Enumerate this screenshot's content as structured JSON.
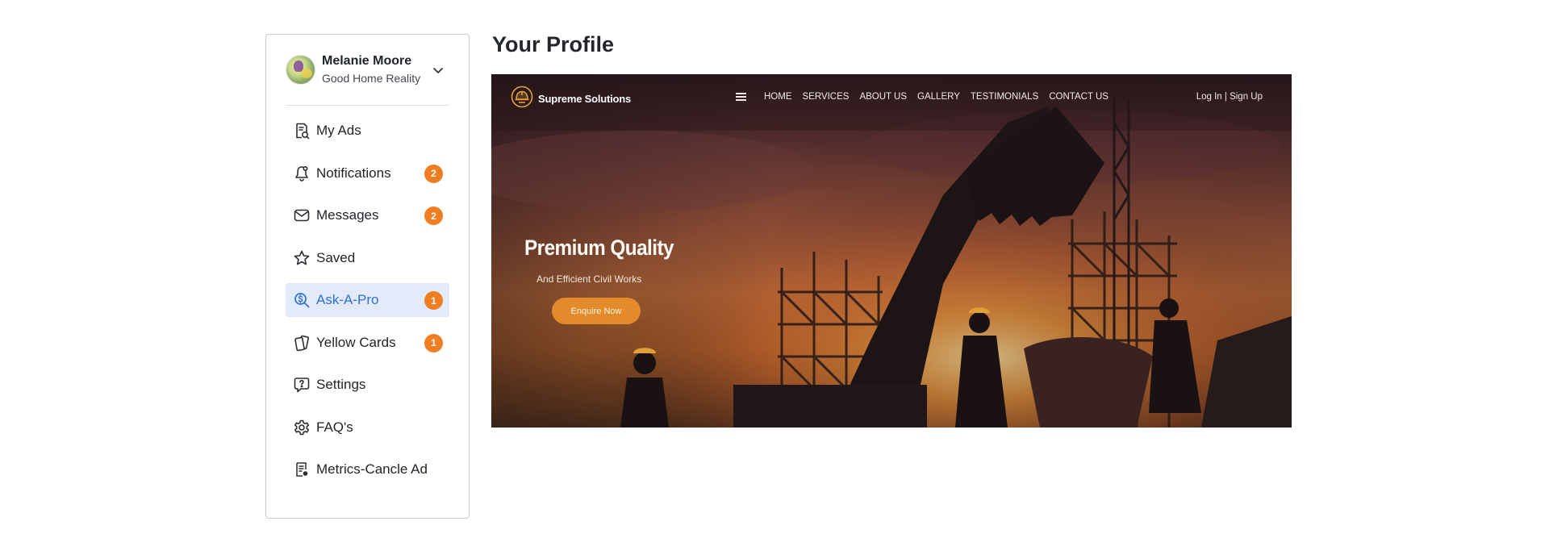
{
  "user": {
    "name": "Melanie Moore",
    "company": "Good Home Reality"
  },
  "sidebar": {
    "items": [
      {
        "label": "My Ads",
        "icon": "search-document-icon",
        "badge": null,
        "active": false
      },
      {
        "label": "Notifications",
        "icon": "bell-icon",
        "badge": "2",
        "active": false
      },
      {
        "label": "Messages",
        "icon": "envelope-icon",
        "badge": "2",
        "active": false
      },
      {
        "label": "Saved",
        "icon": "star-icon",
        "badge": null,
        "active": false
      },
      {
        "label": "Ask-A-Pro",
        "icon": "search-dollar-icon",
        "badge": "1",
        "active": true
      },
      {
        "label": "Yellow Cards",
        "icon": "cards-icon",
        "badge": "1",
        "active": false
      },
      {
        "label": "Settings",
        "icon": "question-bubble-icon",
        "badge": null,
        "active": false
      },
      {
        "label": "FAQ's",
        "icon": "gear-icon",
        "badge": null,
        "active": false
      },
      {
        "label": "Metrics-Cancle Ad",
        "icon": "report-icon",
        "badge": null,
        "active": false
      }
    ]
  },
  "main": {
    "title": "Your Profile"
  },
  "banner": {
    "brand": "Supreme Solutions",
    "menu": [
      "HOME",
      "SERVICES",
      "ABOUT US",
      "GALLERY",
      "TESTIMONIALS",
      "CONTACT US"
    ],
    "auth": "Log In | Sign Up",
    "hero_title": "Premium Quality",
    "hero_subtitle": "And Efficient Civil Works",
    "hero_button": "Enquire Now"
  },
  "colors": {
    "accent": "#2f6fd8",
    "active_bg": "#e3ebfb",
    "badge": "#ef7d22",
    "border": "#c9ccd1"
  }
}
